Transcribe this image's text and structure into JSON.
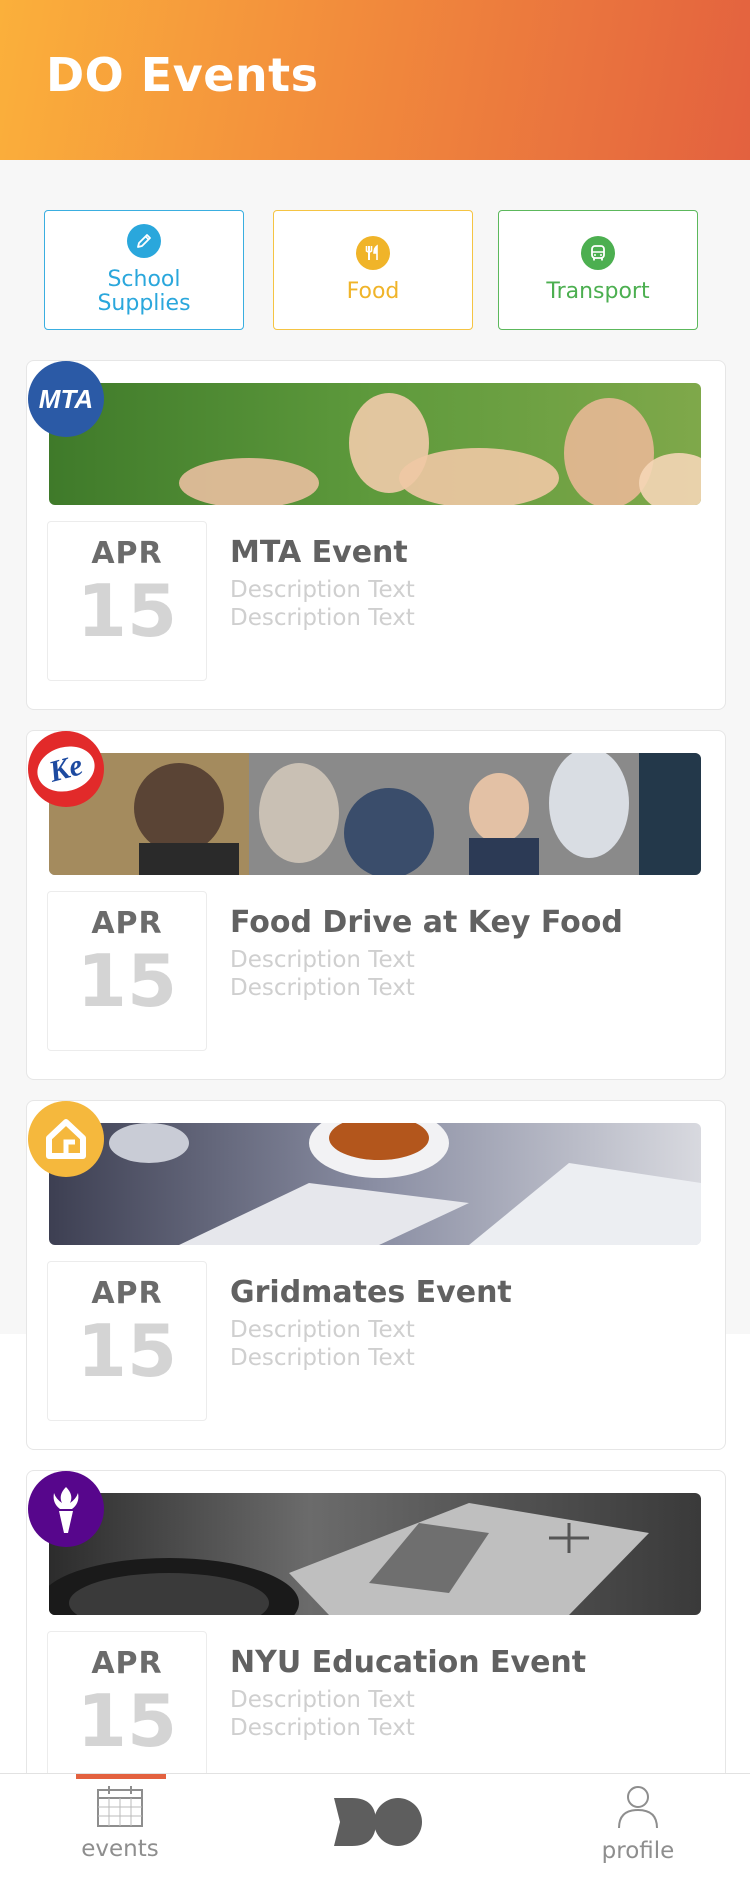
{
  "header": {
    "title": "DO Events"
  },
  "categories": [
    {
      "label_line1": "School",
      "label_line2": "Supplies",
      "icon": "pencil-icon",
      "color": "#2aa7dc"
    },
    {
      "label": "Food",
      "icon": "utensils-icon",
      "color": "#f0b429"
    },
    {
      "label": "Transport",
      "icon": "bus-icon",
      "color": "#4caf50"
    }
  ],
  "events": [
    {
      "logo": "MTA",
      "title": "MTA Event",
      "month": "APR",
      "day": "15",
      "desc1": "Description Text",
      "desc2": "Description Text"
    },
    {
      "logo": "Ke",
      "title": "Food Drive at Key Food",
      "month": "APR",
      "day": "15",
      "desc1": "Description Text",
      "desc2": "Description Text"
    },
    {
      "logo": "",
      "title": "Gridmates Event",
      "month": "APR",
      "day": "15",
      "desc1": "Description Text",
      "desc2": "Description Text"
    },
    {
      "logo": "",
      "title": "NYU Education Event",
      "month": "APR",
      "day": "15",
      "desc1": "Description Text",
      "desc2": "Description Text"
    }
  ],
  "nav": {
    "events_label": "events",
    "profile_label": "profile"
  },
  "colors": {
    "accent": "#e3613f",
    "header_start": "#fbb03b",
    "header_end": "#e3613f"
  }
}
